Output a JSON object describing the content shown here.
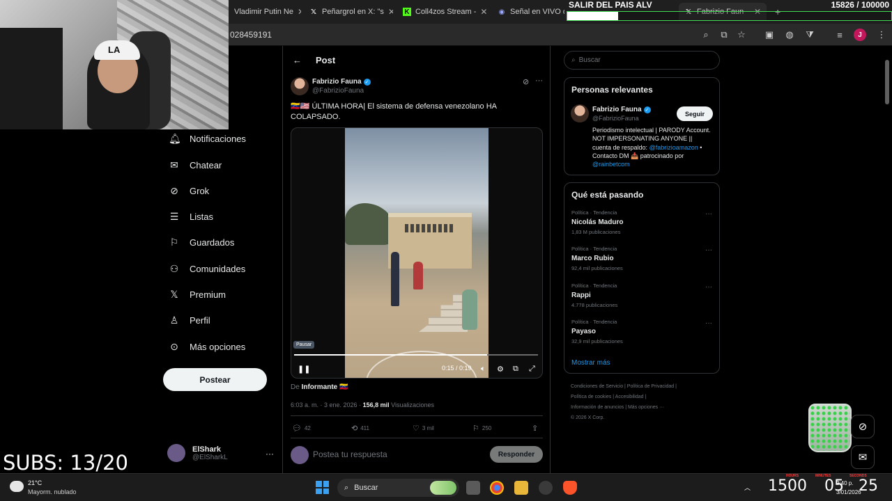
{
  "browser": {
    "tabs": [
      {
        "label": "Vladimir Putin Ne",
        "icon": "globe-icon"
      },
      {
        "label": "Peñargrol en X: \"s",
        "icon": "x-logo-icon"
      },
      {
        "label": "Coll4zos Stream -",
        "icon": "kick-logo-icon"
      },
      {
        "label": "Señal en VIVO de",
        "icon": "stream-logo-icon"
      },
      {
        "label": "Fabrizio Faun",
        "icon": "x-logo-icon",
        "active": true
      }
    ],
    "new_tab": "+",
    "url": "028459191",
    "avatar_letter": "J"
  },
  "overlay": {
    "stream_title": "SALIR DEL PAIS ALV",
    "subs_goal": "15826  / 100000",
    "goal_progress": 0.158,
    "subs_counter": "SUBS: 13/20",
    "webcam_cap_logo": "LA",
    "timer": {
      "hours": "15",
      "hours_label": "HOURS",
      "minutes": "00",
      "minutes_label": "MINUTES",
      "seconds": "25",
      "seconds_label": "SECONDS",
      "display_hours_minutes": "1500",
      "display_min": "05",
      "display_sec": "25"
    }
  },
  "nav": {
    "items": [
      {
        "label": "Notificaciones",
        "icon": "bell-icon"
      },
      {
        "label": "Chatear",
        "icon": "envelope-icon"
      },
      {
        "label": "Grok",
        "icon": "grok-icon"
      },
      {
        "label": "Listas",
        "icon": "list-icon"
      },
      {
        "label": "Guardados",
        "icon": "bookmark-icon"
      },
      {
        "label": "Comunidades",
        "icon": "people-icon"
      },
      {
        "label": "Premium",
        "icon": "x-logo-icon"
      },
      {
        "label": "Perfil",
        "icon": "person-icon"
      },
      {
        "label": "Más opciones",
        "icon": "more-circle-icon"
      }
    ],
    "post_button": "Postear",
    "account": {
      "name": "ElShark",
      "handle": "@ElSharkL",
      "more": "···"
    }
  },
  "post": {
    "header": "Post",
    "author": {
      "name": "Fabrizio Fauna",
      "handle": "@FabrizioFauna"
    },
    "text": "🇻🇪🇺🇸 ÚLTIMA HORA| El sistema de defensa venezolano HA COLAPSADO.",
    "video": {
      "tooltip": "Pausar",
      "time": "0:15 / 0:19",
      "progress": 0.79
    },
    "source_prefix": "De",
    "source_name": "Informante 🇻🇪",
    "timestamp": "6:03 a. m. · 3 ene. 2026 · ",
    "views_count": "156,8 mil",
    "views_label": "Visualizaciones",
    "actions": {
      "replies": "42",
      "reposts": "411",
      "likes": "3 mil",
      "bookmarks": "250"
    },
    "reply_placeholder": "Postea tu respuesta",
    "reply_button": "Responder"
  },
  "sidebar": {
    "search_placeholder": "Buscar",
    "relevant": {
      "title": "Personas relevantes",
      "name": "Fabrizio Fauna",
      "handle": "@FabrizioFauna",
      "follow": "Seguir",
      "bio_text": "Periodismo intelectual | PARODY Account. NOT IMPERSONATING ANYONE || cuenta de respaldo: ",
      "bio_link1": "@fabrizioamazon",
      "bio_mid": " • Contacto DM 📥 patrocinado por ",
      "bio_link2": "@rainbetcom"
    },
    "trending": {
      "title": "Qué está pasando",
      "items": [
        {
          "category": "Política · Tendencia",
          "name": "Nicolás Maduro",
          "count": "1,83 M publicaciones"
        },
        {
          "category": "Política · Tendencia",
          "name": "Marco Rubio",
          "count": "92,4 mil publicaciones"
        },
        {
          "category": "Política · Tendencia",
          "name": "Rappi",
          "count": "4.778 publicaciones"
        },
        {
          "category": "Política · Tendencia",
          "name": "Payaso",
          "count": "32,9 mil publicaciones"
        }
      ],
      "show_more": "Mostrar más"
    },
    "footer": {
      "line1": "Condiciones de Servicio  |  Política de Privacidad  |",
      "line2": "Política de cookies  |  Accesibilidad  |",
      "line3": "Información de anuncios  |  Más opciones ···",
      "line4": "© 2026 X Corp."
    }
  },
  "taskbar": {
    "temperature": "21°C",
    "weather": "Mayorm. nublado",
    "search": "Buscar",
    "clock_time": "2:40 p.",
    "clock_date": "3/01/2026"
  }
}
